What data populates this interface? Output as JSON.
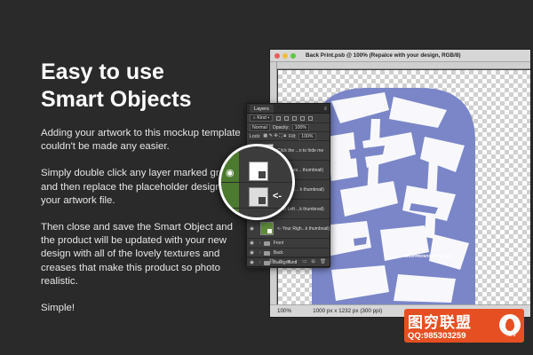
{
  "headline": {
    "line1": "Easy to use",
    "line2": "Smart Objects"
  },
  "body": {
    "p1": "Adding your artwork to this mockup template couldn't be made any easier.",
    "p2": "Simply double click any layer marked green, and then replace the placeholder design with your artwork file.",
    "p3": "Then close and save the Smart Object and the product will be updated with your new design with all of the lovely textures and creases that make this product so photo realistic.",
    "p4": "Simple!"
  },
  "document_window": {
    "title": "Back Print.psb @ 100% (Repalce with your design, RGB/8)",
    "status_zoom": "100%",
    "status_info": "1000 px x 1232 px (300 ppi)",
    "canvas_caption": "SHOPFRONTAMATS.COM",
    "colors": {
      "print_blue": "#7a86c8",
      "checker": "#d0d0d0"
    }
  },
  "layers_panel": {
    "tab": "Layers",
    "menu_icon": "menu-icon",
    "kind_label": "Kind",
    "blend_mode": "Normal",
    "opacity_label": "Opacity:",
    "opacity_value": "100%",
    "lock_label": "Lock:",
    "fill_label": "Fill:",
    "fill_value": "100%",
    "rows": [
      {
        "name": "Click the ...n to hide me",
        "type": "thumb"
      },
      {
        "name": "Your Ches... thumbnail)",
        "type": "thumb"
      },
      {
        "name": "Your Bac... k thumbnail)",
        "type": "thumb"
      },
      {
        "name": "Your Left ...k thumbnail)",
        "type": "thumb"
      },
      {
        "name": "<- Your Righ...k thumbnail)",
        "type": "thumb"
      },
      {
        "name": "Front",
        "type": "folder"
      },
      {
        "name": "Back",
        "type": "folder"
      },
      {
        "name": "Background",
        "type": "folder"
      }
    ]
  },
  "magnifier": {
    "arrow_label": "<-",
    "accent": "#4c7a2e"
  },
  "watermark": {
    "title": "图穷联盟",
    "qq": "QQ:985303259",
    "suffix": ".cn/"
  }
}
